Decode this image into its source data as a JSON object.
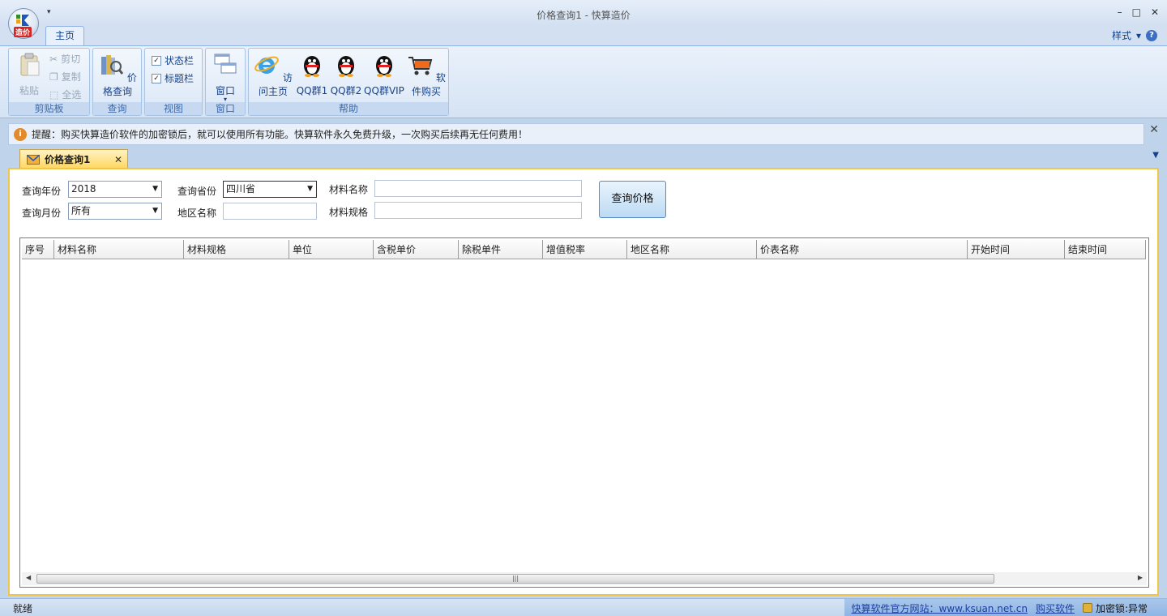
{
  "window": {
    "title": "价格查询1 - 快算造价",
    "orb_label": "造价",
    "min_glyph": "–",
    "max_glyph": "□",
    "close_glyph": "✕"
  },
  "ribbon": {
    "tab": "主页",
    "style_menu": "样式",
    "help_glyph": "?",
    "groups": {
      "clipboard": {
        "label": "剪贴板",
        "paste": "粘贴",
        "cut": "剪切",
        "copy": "复制",
        "select_all": "全选"
      },
      "query": {
        "label": "查询",
        "price_query": "价格查询"
      },
      "view": {
        "label": "视图",
        "status_bar": "状态栏",
        "title_bar": "标题栏"
      },
      "window": {
        "label": "窗口",
        "window": "窗口"
      },
      "help": {
        "label": "帮助",
        "home": "访问主页",
        "qq1": "QQ群1",
        "qq2": "QQ群2",
        "qqvip": "QQ群VIP",
        "buy": "软件购买"
      }
    }
  },
  "notice": {
    "text": "提醒：购买快算造价软件的加密锁后，就可以使用所有功能。快算软件永久免费升级，一次购买后续再无任何费用！",
    "icon_glyph": "i",
    "close_glyph": "✕"
  },
  "doc_tab": {
    "label": "价格查询1",
    "close_glyph": "✕"
  },
  "form": {
    "year_label": "查询年份",
    "year_value": "2018",
    "month_label": "查询月份",
    "month_value": "所有",
    "province_label": "查询省份",
    "province_value": "四川省",
    "region_label": "地区名称",
    "region_value": "",
    "material_name_label": "材料名称",
    "material_name_value": "",
    "material_spec_label": "材料规格",
    "material_spec_value": "",
    "query_button": "查询价格"
  },
  "grid": {
    "columns": [
      "序号",
      "材料名称",
      "材料规格",
      "单位",
      "含税单价",
      "除税单件",
      "增值税率",
      "地区名称",
      "价表名称",
      "开始时间",
      "结束时间"
    ],
    "rows": []
  },
  "status": {
    "ready": "就绪",
    "site_link": "快算软件官方网站：www.ksuan.net.cn",
    "buy_link": "购买软件",
    "lock_status": "加密锁:异常"
  },
  "colors": {
    "accent": "#f1c548",
    "ribbon": "#dbe7f6",
    "link": "#1d3f9e"
  }
}
